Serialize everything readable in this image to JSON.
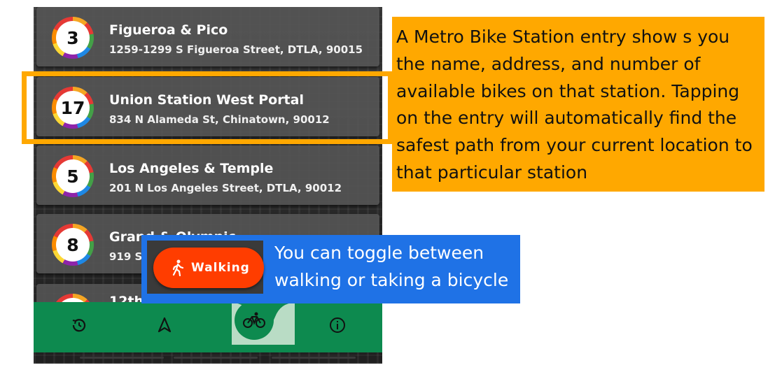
{
  "stations": [
    {
      "count": "3",
      "name": "Figueroa & Pico",
      "address": "1259-1299 S Figueroa Street, DTLA, 90015"
    },
    {
      "count": "17",
      "name": "Union Station West Portal",
      "address": "834 N Alameda St, Chinatown, 90012"
    },
    {
      "count": "5",
      "name": "Los Angeles & Temple",
      "address": "201 N Los Angeles Street, DTLA, 90012"
    },
    {
      "count": "8",
      "name": "Grand & Olympic",
      "address": "919 S"
    },
    {
      "count": "",
      "name": "12th",
      "address": ""
    }
  ],
  "walking_button": {
    "label": "Walking",
    "icon": "walking-person-icon"
  },
  "bottom_nav": {
    "items": [
      "history-icon",
      "navigation-arrow-icon",
      "bicycle-icon",
      "info-icon"
    ],
    "accent": "#0d8a4f"
  },
  "callouts": {
    "station_entry": "A Metro Bike Station entry show s you the name, address, and number of available bikes on that station. Tapping on the entry will automatically find the safest path from your current location to that particular station",
    "toggle": [
      "You can toggle between",
      "walking or taking a bicycle"
    ]
  },
  "colors": {
    "orange": "#ffa800",
    "blue": "#1f72e6",
    "walking_red": "#ff3d00"
  }
}
